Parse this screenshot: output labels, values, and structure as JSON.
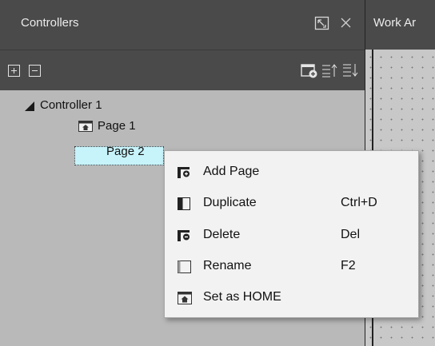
{
  "panel": {
    "title": "Controllers",
    "header_icons": [
      "restore-window-icon",
      "close-icon"
    ]
  },
  "toolbar": {
    "left_icons": [
      "expand-all-icon",
      "collapse-all-icon"
    ],
    "right_icons": [
      "add-page-icon",
      "move-up-icon",
      "move-down-icon"
    ]
  },
  "tree": {
    "controller": "Controller 1",
    "pages": [
      {
        "label": "Page 1",
        "is_home": true
      },
      {
        "label": "Page 2",
        "is_home": false,
        "selected": true
      }
    ]
  },
  "work_area": {
    "tab_label": "Work Ar"
  },
  "context_menu": {
    "items": [
      {
        "label": "Add Page",
        "shortcut": "",
        "icon": "add-page-icon"
      },
      {
        "label": "Duplicate",
        "shortcut": "Ctrl+D",
        "icon": "duplicate-icon"
      },
      {
        "label": "Delete",
        "shortcut": "Del",
        "icon": "delete-icon"
      },
      {
        "label": "Rename",
        "shortcut": "F2",
        "icon": "rename-icon"
      },
      {
        "label": "Set as HOME",
        "shortcut": "",
        "icon": "home-page-icon"
      }
    ]
  },
  "colors": {
    "panel_bg": "#b9b9b9",
    "header_bg": "#4a4a4a",
    "selection_bg": "#c7f3fb",
    "menu_bg": "#f2f2f2"
  }
}
